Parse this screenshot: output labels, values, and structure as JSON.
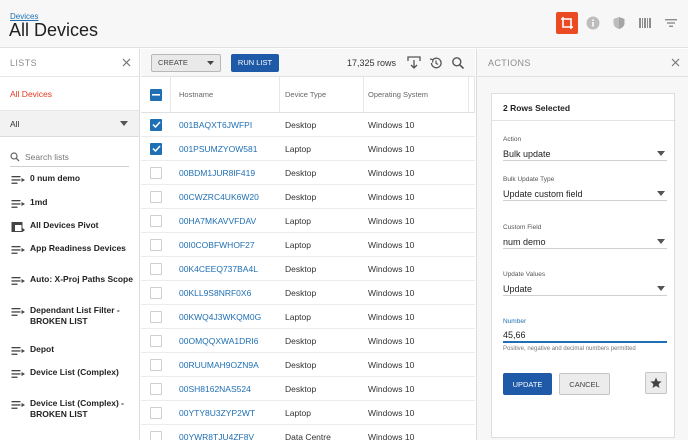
{
  "header": {
    "breadcrumb": "Devices",
    "title": "All Devices",
    "accent_color": "#ea4b22",
    "icons": [
      "crop-icon",
      "info-icon",
      "shield-icon",
      "barcode-icon",
      "filter-icon"
    ]
  },
  "lists": {
    "panel_title": "LISTS",
    "all_devices": "All Devices",
    "select_value": "All",
    "search_placeholder": "Search lists",
    "items": [
      {
        "label": "0 num demo",
        "icon": "list-icon"
      },
      {
        "label": "1md",
        "icon": "list-icon"
      },
      {
        "label": "All Devices Pivot",
        "icon": "pivot-icon"
      },
      {
        "label": "App Readiness Devices",
        "icon": "list-icon"
      },
      {
        "label": "Auto: X-Proj Paths Scope",
        "icon": "list-icon"
      },
      {
        "label": "Dependant List Filter - BROKEN LIST",
        "icon": "list-icon"
      },
      {
        "label": "Depot",
        "icon": "list-icon"
      },
      {
        "label": "Device List (Complex)",
        "icon": "list-icon"
      },
      {
        "label": "Device List (Complex) - BROKEN LIST",
        "icon": "list-icon"
      }
    ]
  },
  "toolbar": {
    "create_label": "CREATE",
    "run_label": "RUN LIST",
    "rows_count": "17,325 rows"
  },
  "table": {
    "columns": [
      "Hostname",
      "Device Type",
      "Operating System"
    ],
    "rows": [
      {
        "checked": true,
        "hostname": "001BAQXT6JWFPI",
        "type": "Desktop",
        "os": "Windows 10"
      },
      {
        "checked": true,
        "hostname": "001PSUMZYOW581",
        "type": "Laptop",
        "os": "Windows 10"
      },
      {
        "checked": false,
        "hostname": "00BDM1JUR8IF419",
        "type": "Desktop",
        "os": "Windows 10"
      },
      {
        "checked": false,
        "hostname": "00CWZRC4UK6W20",
        "type": "Desktop",
        "os": "Windows 10"
      },
      {
        "checked": false,
        "hostname": "00HA7MKAVVFDAV",
        "type": "Laptop",
        "os": "Windows 10"
      },
      {
        "checked": false,
        "hostname": "00I0COBFWHOF27",
        "type": "Laptop",
        "os": "Windows 10"
      },
      {
        "checked": false,
        "hostname": "00K4CEEQ737BA4L",
        "type": "Desktop",
        "os": "Windows 10"
      },
      {
        "checked": false,
        "hostname": "00KLL9S8NRF0X6",
        "type": "Desktop",
        "os": "Windows 10"
      },
      {
        "checked": false,
        "hostname": "00KWQ4J3WKQM0G",
        "type": "Laptop",
        "os": "Windows 10"
      },
      {
        "checked": false,
        "hostname": "00OMQQXWA1DRI6",
        "type": "Desktop",
        "os": "Windows 10"
      },
      {
        "checked": false,
        "hostname": "00RUUMAH9OZN9A",
        "type": "Desktop",
        "os": "Windows 10"
      },
      {
        "checked": false,
        "hostname": "00SH8162NAS524",
        "type": "Desktop",
        "os": "Windows 10"
      },
      {
        "checked": false,
        "hostname": "00YTY8U3ZYP2WT",
        "type": "Laptop",
        "os": "Windows 10"
      },
      {
        "checked": false,
        "hostname": "00YWR8TJU4ZF8V",
        "type": "Data Centre",
        "os": "Windows 10"
      }
    ]
  },
  "actions": {
    "panel_title": "ACTIONS",
    "selected_title": "2 Rows Selected",
    "action_label": "Action",
    "action_value": "Bulk update",
    "bulk_type_label": "Bulk Update Type",
    "bulk_type_value": "Update custom field",
    "custom_field_label": "Custom Field",
    "custom_field_value": "num demo",
    "update_values_label": "Update Values",
    "update_values_value": "Update",
    "number_label": "Number",
    "number_value": "45,66",
    "number_helper": "Positive, negative and decimal numbers permitted",
    "update_button": "UPDATE",
    "cancel_button": "CANCEL",
    "primary_color": "#1e5aa8"
  }
}
